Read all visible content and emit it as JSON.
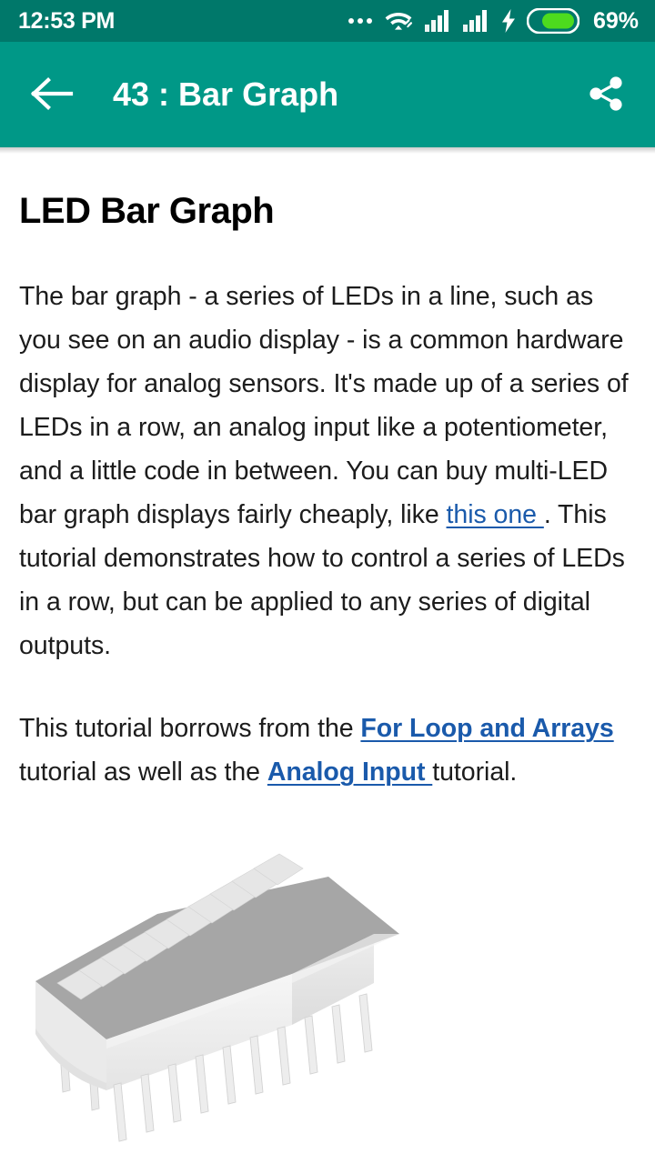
{
  "status_bar": {
    "time": "12:53 PM",
    "battery_percent": "69%",
    "battery_level": 69,
    "icons": [
      "more-dots-icon",
      "wifi-icon",
      "signal-bars-icon",
      "signal-bars-icon",
      "charging-bolt-icon",
      "battery-icon"
    ],
    "background_color": "#00786a"
  },
  "app_bar": {
    "back_icon": "back-arrow-icon",
    "title": "43 : Bar Graph",
    "share_icon": "share-icon",
    "background_color": "#009887"
  },
  "article": {
    "title": "LED Bar Graph",
    "paragraph_1": {
      "part_1": "The bar graph - a series of LEDs in a line, such as you see on an audio display - is a common hardware display for analog sensors. It's made up of a series of LEDs in a row, an analog input like a potentiometer, and a little code in between. You can buy multi-LED bar graph displays fairly cheaply, like ",
      "link_1": "this one ",
      "part_2": ". This tutorial demonstrates how to control a series of LEDs in a row, but can be applied to any series of digital outputs."
    },
    "paragraph_2": {
      "part_1": "This tutorial borrows from the ",
      "link_1": "For Loop and Arrays",
      "part_2": " tutorial as well as the ",
      "link_2": "Analog Input ",
      "part_3": "tutorial."
    },
    "figure": {
      "name": "led-bar-graph-display-image",
      "segments": 10,
      "pins": 10,
      "body_color": "#f2f2f2",
      "top_face_color": "#a8a8a8",
      "segment_color": "#e8e8e8"
    },
    "link_color": "#1a5aab",
    "text_color": "#1c1c1c"
  }
}
